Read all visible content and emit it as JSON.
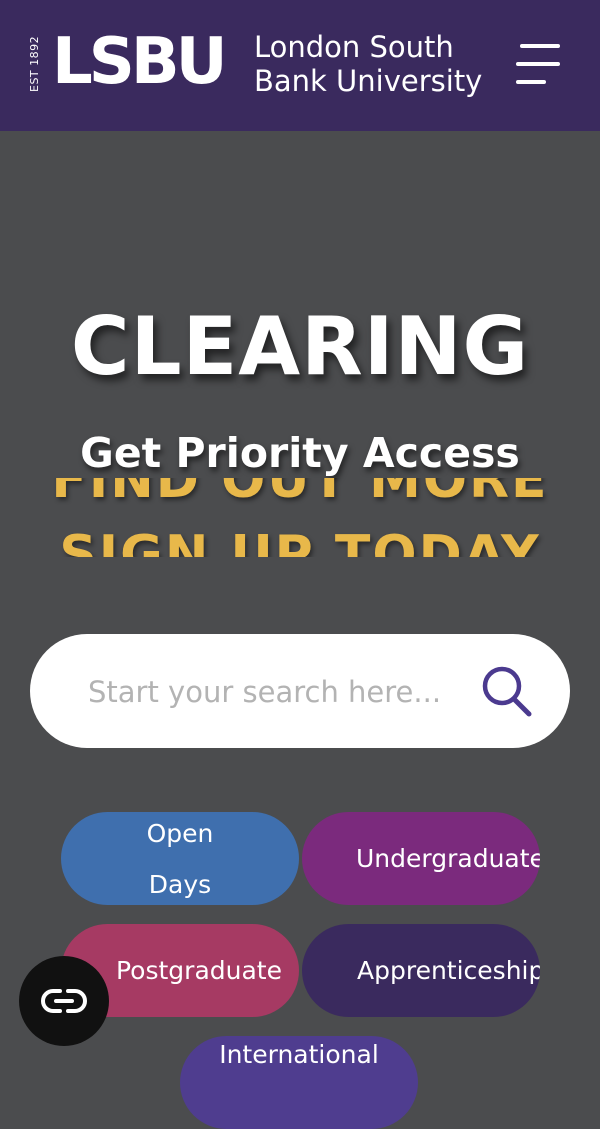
{
  "header": {
    "est": "EST 1892",
    "logo": "LSBU",
    "name_line1": "London South",
    "name_line2": "Bank University",
    "menu_icon": "hamburger-menu-icon"
  },
  "hero": {
    "title": "CLEARING",
    "subtitle": "Get Priority Access",
    "cta_line1": "FIND OUT MORE",
    "cta_line2": "SIGN UP TODAY"
  },
  "search": {
    "placeholder": "Start your search here...",
    "icon": "search-icon"
  },
  "quick_links": [
    {
      "label": "Open Days",
      "color": "#3f6fae"
    },
    {
      "label": "Undergraduate",
      "color": "#7b2a7d"
    },
    {
      "label": "Postgraduate",
      "color": "#a63a63"
    },
    {
      "label": "Apprenticeships",
      "color": "#3a2a5e"
    },
    {
      "label": "International",
      "color": "#4f3d8f"
    }
  ],
  "chat": {
    "icon": "chat-link-icon"
  },
  "colors": {
    "brand_purple": "#3a2a5e",
    "hero_bg": "#4b4c4e",
    "cta_gold": "#e8b84a",
    "search_icon": "#4b3a8f"
  }
}
